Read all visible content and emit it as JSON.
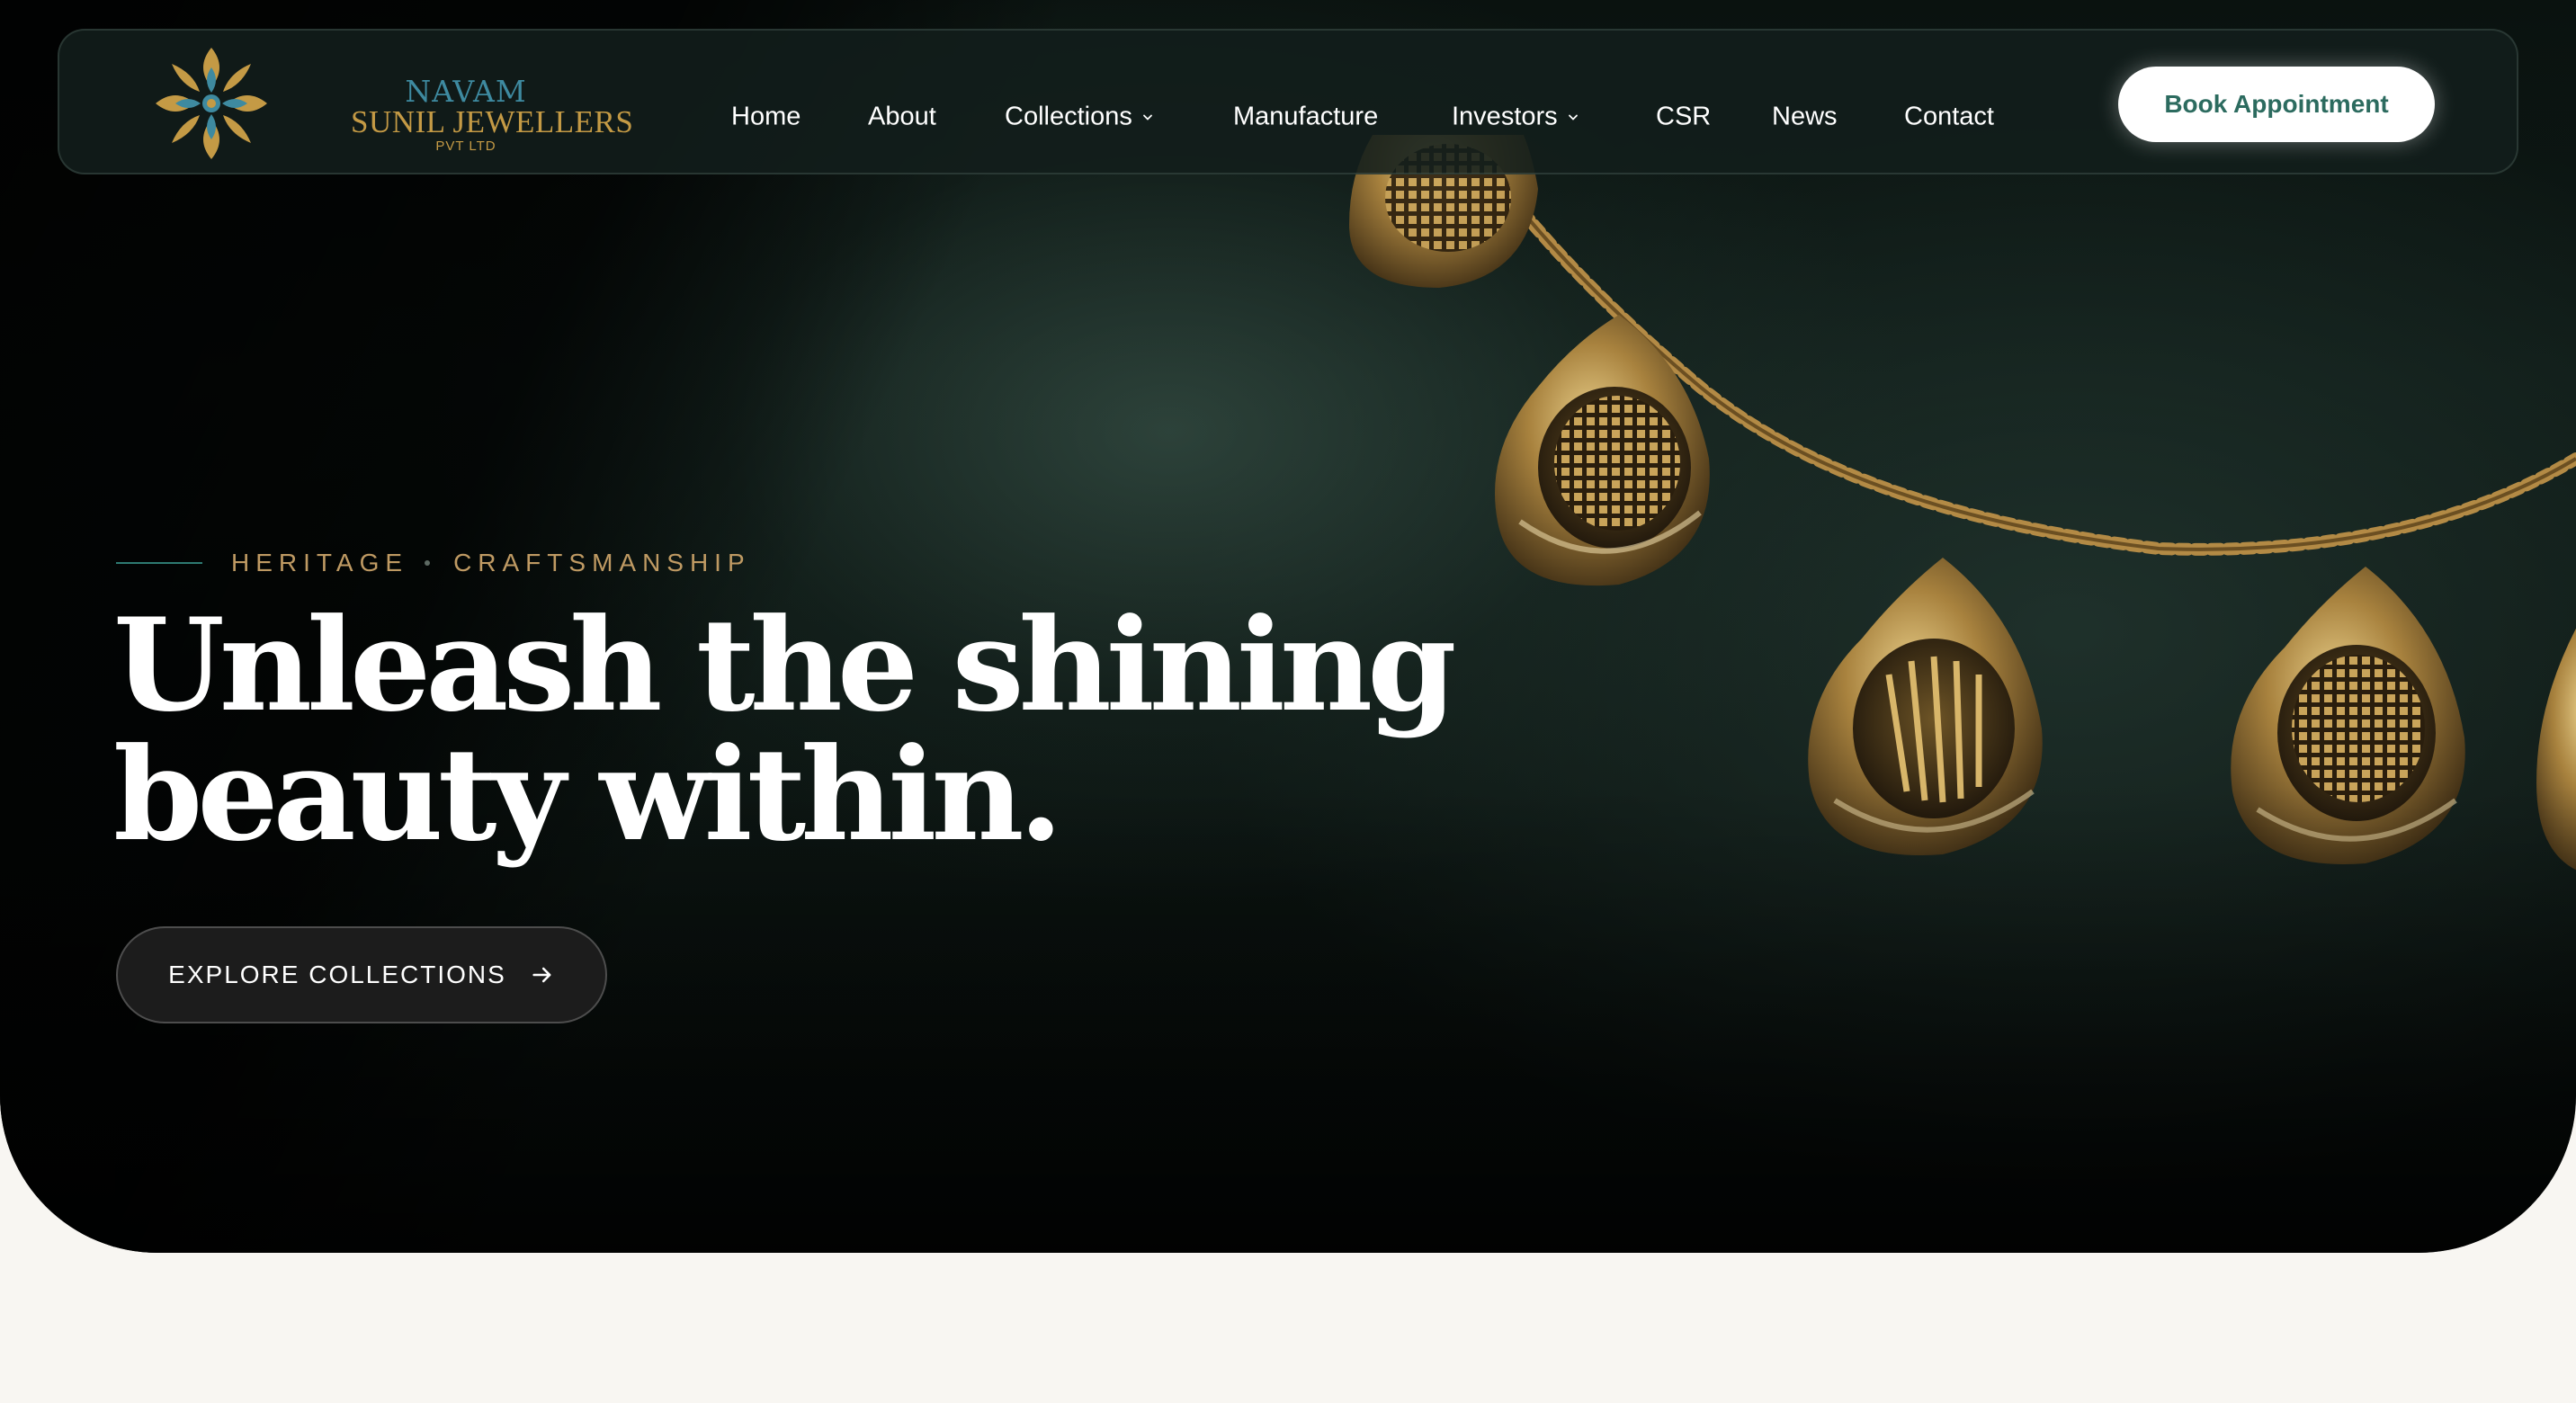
{
  "brand": {
    "line1": "NAVAM",
    "line2": "SUNIL JEWELLERS",
    "line3": "PVT LTD",
    "gold": "#c49a45",
    "teal": "#3e8aa0"
  },
  "nav": {
    "items": [
      {
        "label": "Home"
      },
      {
        "label": "About"
      },
      {
        "label": "Collections",
        "has_dropdown": true
      },
      {
        "label": "Manufacture"
      },
      {
        "label": "Investors",
        "has_dropdown": true
      },
      {
        "label": "CSR"
      },
      {
        "label": "News"
      },
      {
        "label": "Contact"
      }
    ],
    "cta_label": "Book Appointment"
  },
  "hero": {
    "eyebrow": [
      "HERITAGE",
      "CRAFTSMANSHIP"
    ],
    "headline_line1": "Unleash the shining",
    "headline_line2": "beauty within.",
    "cta_label": "EXPLORE COLLECTIONS",
    "cta_icon": "arrow-right-icon",
    "image": "gold-necklace-with-teardrop-pendants"
  },
  "colors": {
    "accent_gold": "#bf9a63",
    "accent_teal": "#2e7a72",
    "cta_text": "#2c6b5f",
    "page_background": "#f8f6f2"
  }
}
